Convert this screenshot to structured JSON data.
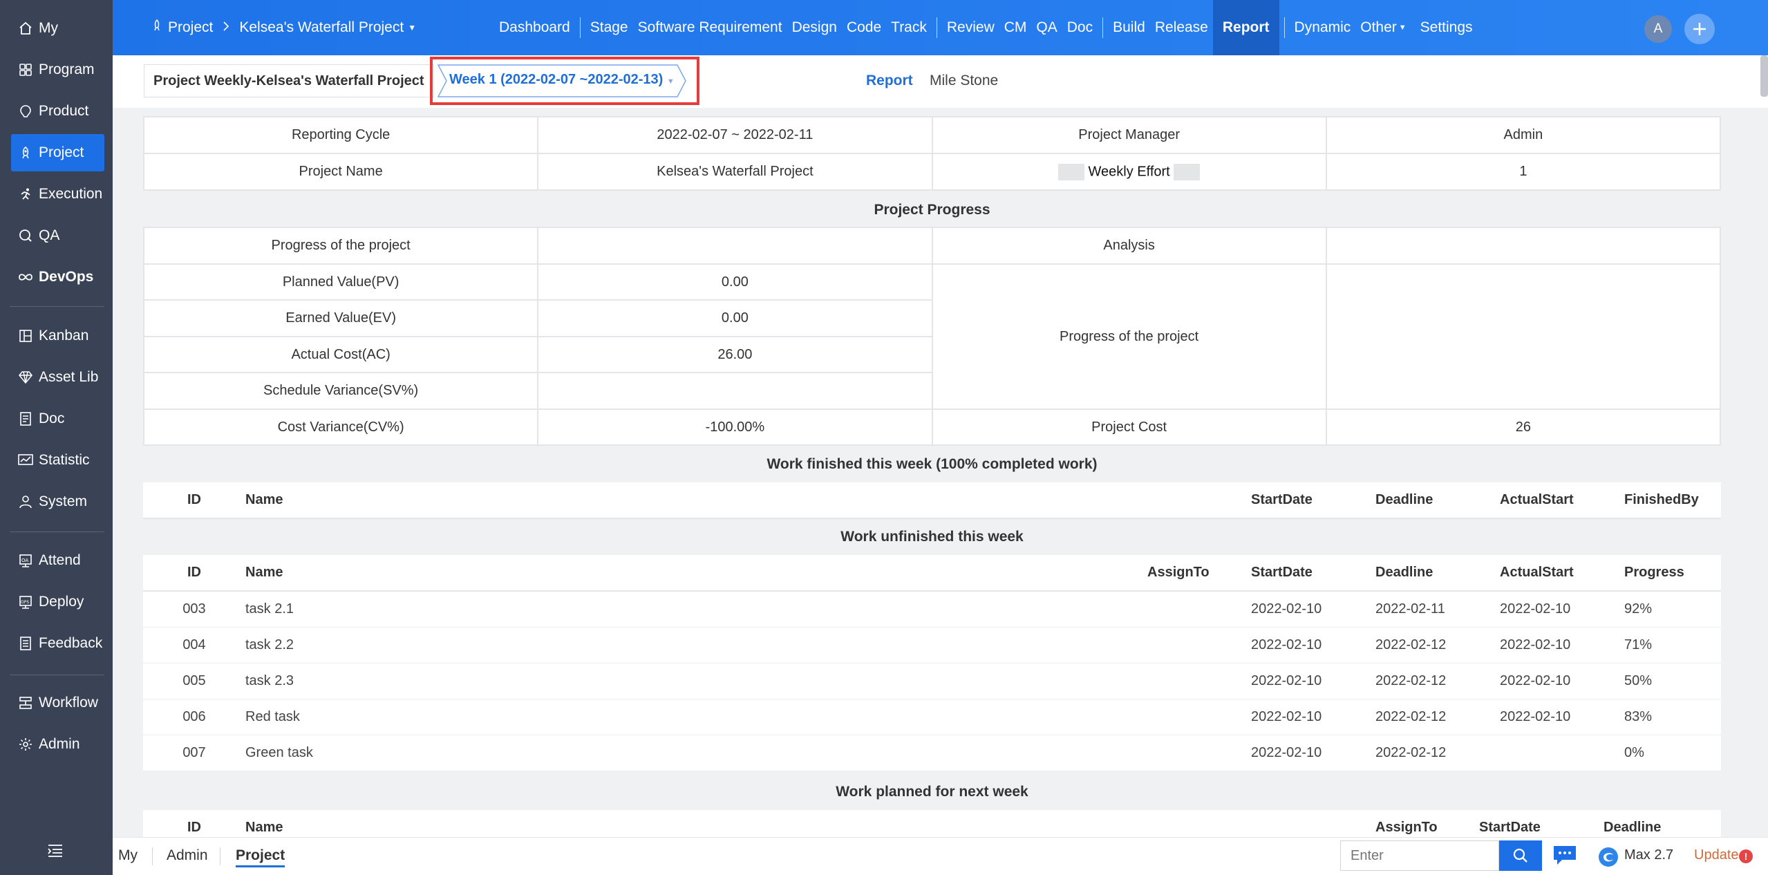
{
  "sidebar": {
    "items": [
      {
        "label": "My",
        "icon": "home-icon"
      },
      {
        "label": "Program",
        "icon": "program-icon"
      },
      {
        "label": "Product",
        "icon": "product-icon"
      },
      {
        "label": "Project",
        "icon": "project-icon",
        "active": true
      },
      {
        "label": "Execution",
        "icon": "execution-icon"
      },
      {
        "label": "QA",
        "icon": "qa-icon"
      },
      {
        "label": "DevOps",
        "icon": "devops-icon"
      },
      {
        "label": "Kanban",
        "icon": "kanban-icon"
      },
      {
        "label": "Asset Lib",
        "icon": "asset-lib-icon"
      },
      {
        "label": "Doc",
        "icon": "doc-icon"
      },
      {
        "label": "Statistic",
        "icon": "statistic-icon"
      },
      {
        "label": "System",
        "icon": "system-icon"
      },
      {
        "label": "Attend",
        "icon": "attend-icon"
      },
      {
        "label": "Deploy",
        "icon": "deploy-icon"
      },
      {
        "label": "Feedback",
        "icon": "feedback-icon"
      },
      {
        "label": "Workflow",
        "icon": "workflow-icon"
      },
      {
        "label": "Admin",
        "icon": "admin-icon"
      }
    ]
  },
  "topbar": {
    "crumb_root": "Project",
    "crumb_project": "Kelsea's Waterfall Project",
    "nav": [
      "Dashboard",
      "Stage",
      "Software Requirement",
      "Design",
      "Code",
      "Track",
      "Review",
      "CM",
      "QA",
      "Doc",
      "Build",
      "Release",
      "Report",
      "Dynamic",
      "Other",
      "Settings"
    ],
    "active_nav": "Report",
    "avatar_letter": "A"
  },
  "subheader": {
    "weekly_title": "Project Weekly-Kelsea's Waterfall Project",
    "week_selector": "Week 1 (2022-02-07 ~2022-02-13)",
    "tab_report": "Report",
    "tab_milestone": "Mile Stone"
  },
  "summary": {
    "reporting_cycle_label": "Reporting Cycle",
    "reporting_cycle_value": "2022-02-07 ~ 2022-02-11",
    "project_manager_label": "Project Manager",
    "project_manager_value": "Admin",
    "project_name_label": "Project Name",
    "project_name_value": "Kelsea's Waterfall Project",
    "weekly_effort_label": "Weekly Effort",
    "weekly_effort_value": "1"
  },
  "progress": {
    "title": "Project Progress",
    "progress_label": "Progress of the project",
    "analysis_label": "Analysis",
    "pv_label": "Planned Value(PV)",
    "pv_value": "0.00",
    "ev_label": "Earned Value(EV)",
    "ev_value": "0.00",
    "ac_label": "Actual Cost(AC)",
    "ac_value": "26.00",
    "sv_label": "Schedule Variance(SV%)",
    "sv_value": "",
    "cv_label": "Cost Variance(CV%)",
    "cv_value": "-100.00%",
    "analysis_progress_label": "Progress of the project",
    "project_cost_label": "Project Cost",
    "project_cost_value": "26"
  },
  "finished": {
    "title": "Work finished this week (100% completed work)",
    "headers": {
      "id": "ID",
      "name": "Name",
      "start": "StartDate",
      "deadline": "Deadline",
      "actual": "ActualStart",
      "finished_by": "FinishedBy"
    }
  },
  "unfinished": {
    "title": "Work unfinished this week",
    "headers": {
      "id": "ID",
      "name": "Name",
      "assign": "AssignTo",
      "start": "StartDate",
      "deadline": "Deadline",
      "actual": "ActualStart",
      "progress": "Progress"
    },
    "rows": [
      {
        "id": "003",
        "name": "task 2.1",
        "assign": "",
        "start": "2022-02-10",
        "deadline": "2022-02-11",
        "actual": "2022-02-10",
        "progress": "92%"
      },
      {
        "id": "004",
        "name": "task 2.2",
        "assign": "",
        "start": "2022-02-10",
        "deadline": "2022-02-12",
        "actual": "2022-02-10",
        "progress": "71%"
      },
      {
        "id": "005",
        "name": "task 2.3",
        "assign": "",
        "start": "2022-02-10",
        "deadline": "2022-02-12",
        "actual": "2022-02-10",
        "progress": "50%"
      },
      {
        "id": "006",
        "name": "Red task",
        "assign": "",
        "start": "2022-02-10",
        "deadline": "2022-02-12",
        "actual": "2022-02-10",
        "progress": "83%"
      },
      {
        "id": "007",
        "name": "Green task",
        "assign": "",
        "start": "2022-02-10",
        "deadline": "2022-02-12",
        "actual": "",
        "progress": "0%"
      }
    ]
  },
  "planned": {
    "title": "Work planned for next week",
    "headers": {
      "id": "ID",
      "name": "Name",
      "assign": "AssignTo",
      "start": "StartDate",
      "deadline": "Deadline"
    }
  },
  "bottombar": {
    "tabs": [
      "My",
      "Admin",
      "Project"
    ],
    "active_tab": "Project",
    "search_placeholder": "Enter",
    "version": "Max 2.7",
    "update": "Update"
  },
  "colors": {
    "accent": "#1d6fe6",
    "sidebar_bg": "#3a4356",
    "highlight_border": "#e63b3b",
    "update": "#d26a36"
  }
}
